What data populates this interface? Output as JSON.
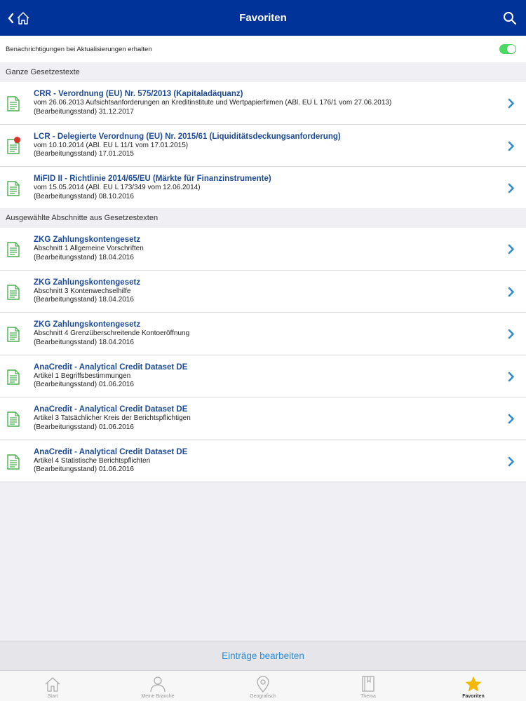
{
  "header": {
    "title": "Favoriten",
    "bg_color": "#003399"
  },
  "notifications": {
    "label": "Benachrichtigungen bei Aktualisierungen erhalten",
    "enabled": true
  },
  "sections": [
    {
      "header": "Ganze Gesetzestexte",
      "items": [
        {
          "title": "CRR - Verordnung (EU) Nr. 575/2013 (Kapitaladäquanz)",
          "line1": "vom 26.06.2013 Aufsichtsanforderungen an Kreditinstitute und Wertpapierfirmen (ABl. EU L 176/1 vom 27.06.2013)",
          "line2": "(Bearbeitungsstand) 31.12.2017",
          "badge": false
        },
        {
          "title": "LCR - Delegierte Verordnung (EU) Nr. 2015/61 (Liquiditätsdeckungsanforderung)",
          "line1": "vom 10.10.2014 (ABl. EU L 11/1 vom 17.01.2015)",
          "line2": "(Bearbeitungsstand) 17.01.2015",
          "badge": true
        },
        {
          "title": "MiFID II - Richtlinie 2014/65/EU (Märkte für Finanzinstrumente)",
          "line1": "vom 15.05.2014 (ABl. EU L 173/349 vom 12.06.2014)",
          "line2": "(Bearbeitungsstand) 08.10.2016",
          "badge": false
        }
      ]
    },
    {
      "header": "Ausgewählte Abschnitte aus Gesetzestexten",
      "items": [
        {
          "title": "ZKG Zahlungskontengesetz",
          "line1": "Abschnitt 1 Allgemeine Vorschriften",
          "line2": "(Bearbeitungsstand) 18.04.2016"
        },
        {
          "title": "ZKG Zahlungskontengesetz",
          "line1": "Abschnitt 3 Kontenwechselhilfe",
          "line2": "(Bearbeitungsstand) 18.04.2016"
        },
        {
          "title": "ZKG Zahlungskontengesetz",
          "line1": "Abschnitt 4 Grenzüberschreitende Kontoeröffnung",
          "line2": "(Bearbeitungsstand) 18.04.2016"
        },
        {
          "title": "AnaCredit - Analytical Credit Dataset DE",
          "line1": "Artikel 1 Begriffsbestimmungen",
          "line2": "(Bearbeitungsstand) 01.06.2016"
        },
        {
          "title": "AnaCredit - Analytical Credit Dataset DE",
          "line1": "Artikel 3 Tatsächlicher Kreis der Berichtspflichtigen",
          "line2": "(Bearbeitungsstand) 01.06.2016"
        },
        {
          "title": "AnaCredit - Analytical Credit Dataset DE",
          "line1": "Artikel 4 Statistische Berichtspflichten",
          "line2": "(Bearbeitungsstand) 01.06.2016"
        }
      ]
    }
  ],
  "edit_button": "Einträge bearbeiten",
  "tabs": [
    {
      "label": "Start",
      "icon": "home-icon"
    },
    {
      "label": "Meine Branche",
      "icon": "person-icon"
    },
    {
      "label": "Geografisch",
      "icon": "location-pin-icon"
    },
    {
      "label": "Thema",
      "icon": "book-icon"
    },
    {
      "label": "Favoriten",
      "icon": "star-icon",
      "active": true
    }
  ],
  "colors": {
    "accent": "#2f8bd4",
    "title_blue": "#1e4b96",
    "doc_icon": "#4caf50",
    "badge": "#d9342b",
    "star": "#f5b800"
  }
}
